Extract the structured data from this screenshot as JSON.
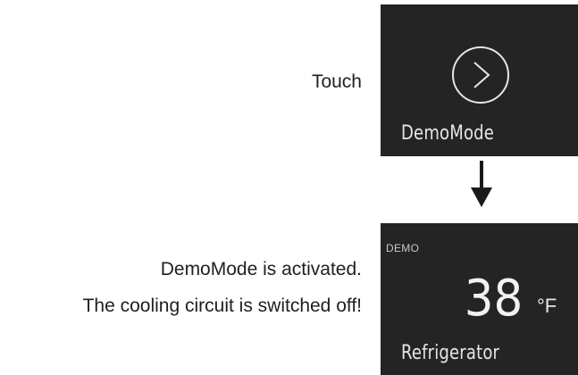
{
  "steps": {
    "touch_label": "Touch",
    "activated_label": "DemoMode is activated.",
    "cooling_label": "The cooling circuit is switched off!"
  },
  "panel_top": {
    "title": "DemoMode",
    "icon": "chevron-right-circle-icon"
  },
  "panel_bottom": {
    "demo_tag": "DEMO",
    "temperature": "38",
    "unit": "°F",
    "title": "Refrigerator"
  },
  "colors": {
    "panel_background": "#242424",
    "panel_text": "#e6e6e6",
    "arrow": "#1a1a1a"
  },
  "arrow_icon": "arrow-down-icon"
}
